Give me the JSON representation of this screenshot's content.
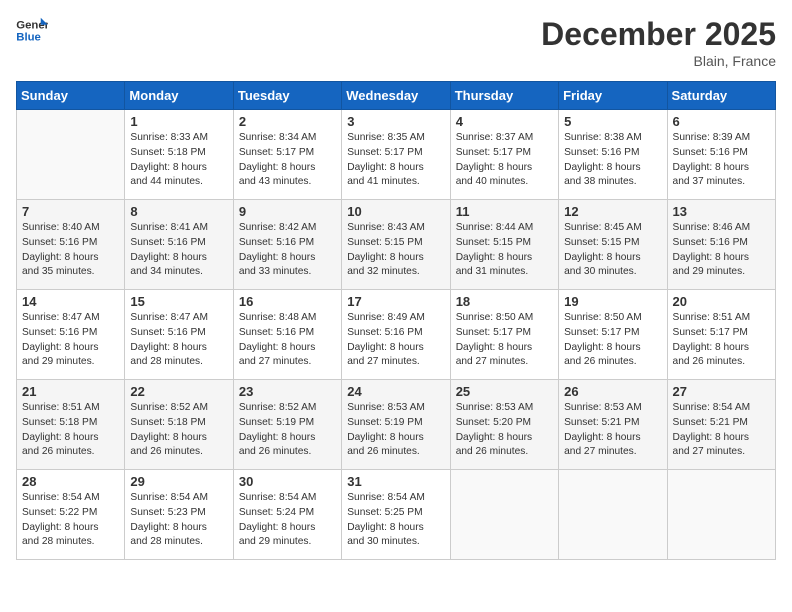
{
  "logo": {
    "line1": "General",
    "line2": "Blue"
  },
  "title": "December 2025",
  "location": "Blain, France",
  "days_header": [
    "Sunday",
    "Monday",
    "Tuesday",
    "Wednesday",
    "Thursday",
    "Friday",
    "Saturday"
  ],
  "weeks": [
    [
      {
        "num": "",
        "info": ""
      },
      {
        "num": "1",
        "info": "Sunrise: 8:33 AM\nSunset: 5:18 PM\nDaylight: 8 hours\nand 44 minutes."
      },
      {
        "num": "2",
        "info": "Sunrise: 8:34 AM\nSunset: 5:17 PM\nDaylight: 8 hours\nand 43 minutes."
      },
      {
        "num": "3",
        "info": "Sunrise: 8:35 AM\nSunset: 5:17 PM\nDaylight: 8 hours\nand 41 minutes."
      },
      {
        "num": "4",
        "info": "Sunrise: 8:37 AM\nSunset: 5:17 PM\nDaylight: 8 hours\nand 40 minutes."
      },
      {
        "num": "5",
        "info": "Sunrise: 8:38 AM\nSunset: 5:16 PM\nDaylight: 8 hours\nand 38 minutes."
      },
      {
        "num": "6",
        "info": "Sunrise: 8:39 AM\nSunset: 5:16 PM\nDaylight: 8 hours\nand 37 minutes."
      }
    ],
    [
      {
        "num": "7",
        "info": "Sunrise: 8:40 AM\nSunset: 5:16 PM\nDaylight: 8 hours\nand 35 minutes."
      },
      {
        "num": "8",
        "info": "Sunrise: 8:41 AM\nSunset: 5:16 PM\nDaylight: 8 hours\nand 34 minutes."
      },
      {
        "num": "9",
        "info": "Sunrise: 8:42 AM\nSunset: 5:16 PM\nDaylight: 8 hours\nand 33 minutes."
      },
      {
        "num": "10",
        "info": "Sunrise: 8:43 AM\nSunset: 5:15 PM\nDaylight: 8 hours\nand 32 minutes."
      },
      {
        "num": "11",
        "info": "Sunrise: 8:44 AM\nSunset: 5:15 PM\nDaylight: 8 hours\nand 31 minutes."
      },
      {
        "num": "12",
        "info": "Sunrise: 8:45 AM\nSunset: 5:15 PM\nDaylight: 8 hours\nand 30 minutes."
      },
      {
        "num": "13",
        "info": "Sunrise: 8:46 AM\nSunset: 5:16 PM\nDaylight: 8 hours\nand 29 minutes."
      }
    ],
    [
      {
        "num": "14",
        "info": "Sunrise: 8:47 AM\nSunset: 5:16 PM\nDaylight: 8 hours\nand 29 minutes."
      },
      {
        "num": "15",
        "info": "Sunrise: 8:47 AM\nSunset: 5:16 PM\nDaylight: 8 hours\nand 28 minutes."
      },
      {
        "num": "16",
        "info": "Sunrise: 8:48 AM\nSunset: 5:16 PM\nDaylight: 8 hours\nand 27 minutes."
      },
      {
        "num": "17",
        "info": "Sunrise: 8:49 AM\nSunset: 5:16 PM\nDaylight: 8 hours\nand 27 minutes."
      },
      {
        "num": "18",
        "info": "Sunrise: 8:50 AM\nSunset: 5:17 PM\nDaylight: 8 hours\nand 27 minutes."
      },
      {
        "num": "19",
        "info": "Sunrise: 8:50 AM\nSunset: 5:17 PM\nDaylight: 8 hours\nand 26 minutes."
      },
      {
        "num": "20",
        "info": "Sunrise: 8:51 AM\nSunset: 5:17 PM\nDaylight: 8 hours\nand 26 minutes."
      }
    ],
    [
      {
        "num": "21",
        "info": "Sunrise: 8:51 AM\nSunset: 5:18 PM\nDaylight: 8 hours\nand 26 minutes."
      },
      {
        "num": "22",
        "info": "Sunrise: 8:52 AM\nSunset: 5:18 PM\nDaylight: 8 hours\nand 26 minutes."
      },
      {
        "num": "23",
        "info": "Sunrise: 8:52 AM\nSunset: 5:19 PM\nDaylight: 8 hours\nand 26 minutes."
      },
      {
        "num": "24",
        "info": "Sunrise: 8:53 AM\nSunset: 5:19 PM\nDaylight: 8 hours\nand 26 minutes."
      },
      {
        "num": "25",
        "info": "Sunrise: 8:53 AM\nSunset: 5:20 PM\nDaylight: 8 hours\nand 26 minutes."
      },
      {
        "num": "26",
        "info": "Sunrise: 8:53 AM\nSunset: 5:21 PM\nDaylight: 8 hours\nand 27 minutes."
      },
      {
        "num": "27",
        "info": "Sunrise: 8:54 AM\nSunset: 5:21 PM\nDaylight: 8 hours\nand 27 minutes."
      }
    ],
    [
      {
        "num": "28",
        "info": "Sunrise: 8:54 AM\nSunset: 5:22 PM\nDaylight: 8 hours\nand 28 minutes."
      },
      {
        "num": "29",
        "info": "Sunrise: 8:54 AM\nSunset: 5:23 PM\nDaylight: 8 hours\nand 28 minutes."
      },
      {
        "num": "30",
        "info": "Sunrise: 8:54 AM\nSunset: 5:24 PM\nDaylight: 8 hours\nand 29 minutes."
      },
      {
        "num": "31",
        "info": "Sunrise: 8:54 AM\nSunset: 5:25 PM\nDaylight: 8 hours\nand 30 minutes."
      },
      {
        "num": "",
        "info": ""
      },
      {
        "num": "",
        "info": ""
      },
      {
        "num": "",
        "info": ""
      }
    ]
  ]
}
